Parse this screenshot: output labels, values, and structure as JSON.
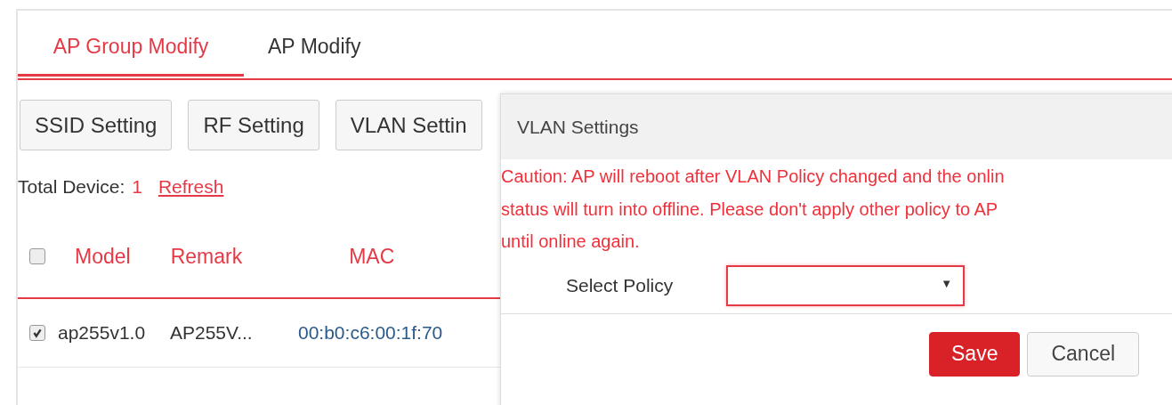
{
  "tabs": [
    {
      "label": "AP Group Modify",
      "selected": true
    },
    {
      "label": "AP Modify",
      "selected": false
    }
  ],
  "toolbar": [
    "SSID Setting",
    "RF Setting",
    "VLAN Settin"
  ],
  "summary": {
    "label": "Total Device:",
    "count": "1",
    "link": "Refresh"
  },
  "table": {
    "select_all": {
      "checked": false
    },
    "columns": [
      "Model",
      "Remark",
      "MAC"
    ],
    "rows": [
      {
        "checked": true,
        "model": "ap255v1.0",
        "remark": "AP255V...",
        "mac": "00:b0:c6:00:1f:70"
      }
    ]
  },
  "dialog": {
    "title": "VLAN Settings",
    "caution": [
      "Caution: AP will reboot after VLAN Policy changed and the onlin",
      "status will turn into offline. Please don't apply other policy to AP",
      "until online again."
    ],
    "field_label": "Select Policy",
    "dropdown_arrow": "▼",
    "buttons": [
      {
        "label": "Save",
        "kind": "primary"
      },
      {
        "label": "Cancel",
        "kind": "secondary"
      }
    ]
  }
}
